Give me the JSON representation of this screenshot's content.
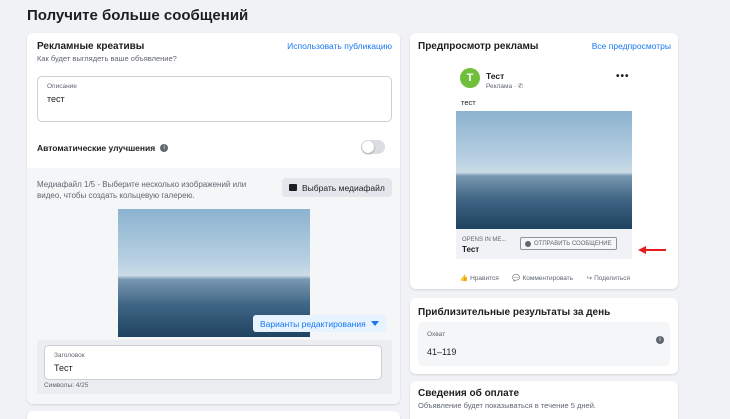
{
  "page": {
    "title": "Получите больше сообщений"
  },
  "creative": {
    "title": "Рекламные креативы",
    "use_post_link": "Использовать публикацию",
    "subtitle": "Как будет выглядеть ваше объявление?",
    "description_label": "Описание",
    "description_value": "тест",
    "auto_improvements_label": "Автоматические улучшения",
    "media_text": "Медиафайл 1/5 - Выберите несколько изображений или видео, чтобы создать кольцевую галерею.",
    "choose_media_label": "Выбрать медиафайл",
    "variants_label": "Варианты редактирования",
    "headline_label": "Заголовок",
    "headline_value": "Тест",
    "char_count": "Символы: 4/25"
  },
  "preview": {
    "title": "Предпросмотр рекламы",
    "all_previews_link": "Все предпросмотры",
    "avatar_letter": "T",
    "page_name": "Тест",
    "sponsored": "Реклама · ✆",
    "post_text": "тест",
    "opens_in": "OPENS IN ME...",
    "footer_title": "Тест",
    "send_message_label": "ОТПРАВИТЬ СООБЩЕНИЕ",
    "like_label": "Нравится",
    "comment_label": "Комментировать",
    "share_label": "Поделиться",
    "arrow_color": "#e41e1e"
  },
  "results": {
    "title": "Приблизительные результаты за день",
    "reach_label": "Охват",
    "reach_value": "41–119"
  },
  "payment": {
    "title": "Сведения об оплате",
    "note": "Объявление будет показываться в течение 5 дней."
  }
}
